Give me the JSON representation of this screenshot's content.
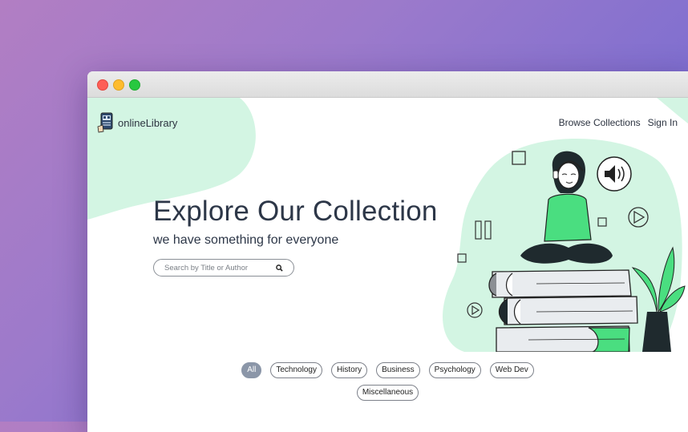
{
  "window": {
    "controls": [
      "close",
      "minimize",
      "zoom"
    ]
  },
  "brand": {
    "name": "onlineLibrary",
    "icon": "book-reader-icon"
  },
  "nav": {
    "browse": "Browse Collections",
    "signin": "Sign In"
  },
  "hero": {
    "title": "Explore Our Collection",
    "subtitle": "we have something for everyone"
  },
  "search": {
    "placeholder": "Search by Title or Author",
    "value": "",
    "icon": "search-icon"
  },
  "filters": [
    {
      "label": "All",
      "active": true
    },
    {
      "label": "Technology",
      "active": false
    },
    {
      "label": "History",
      "active": false
    },
    {
      "label": "Business",
      "active": false
    },
    {
      "label": "Psychology",
      "active": false
    },
    {
      "label": "Web Dev",
      "active": false
    },
    {
      "label": "Miscellaneous",
      "active": false
    }
  ],
  "colors": {
    "accent": "#d3f5e3",
    "text": "#2d3748",
    "active_chip": "#8b96a8",
    "green": "#4ade80"
  }
}
